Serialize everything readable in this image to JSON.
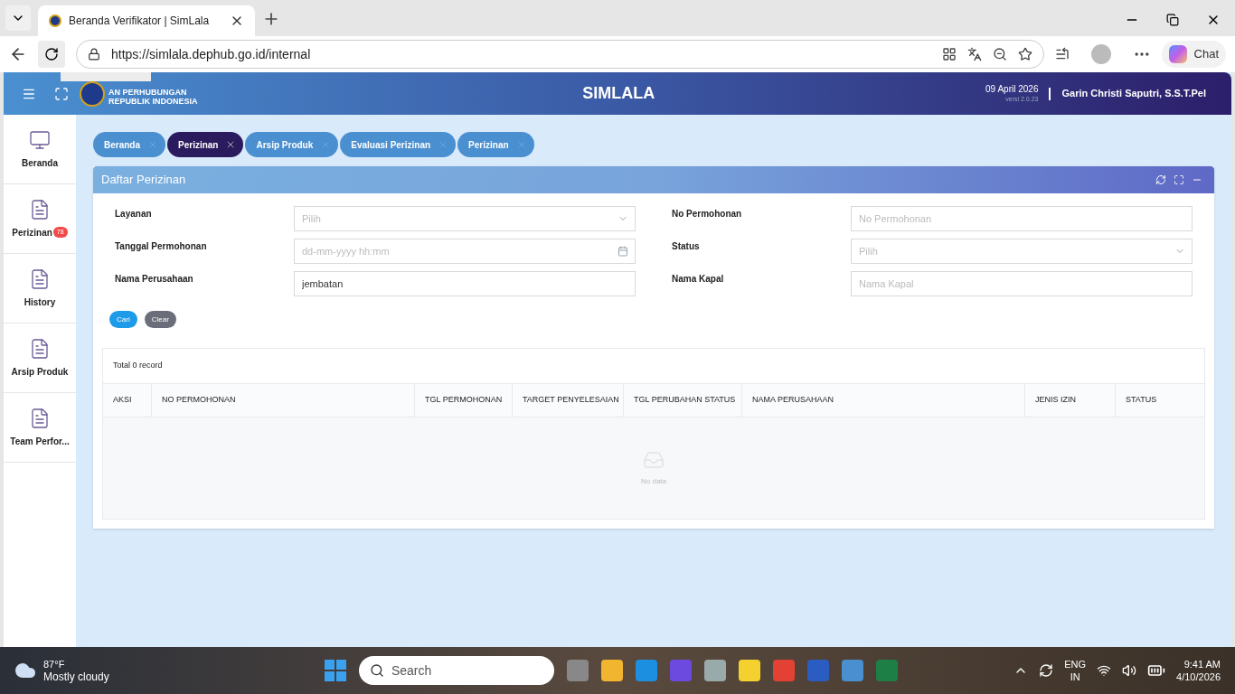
{
  "browser": {
    "tabs": [
      {
        "title": "Beranda Verifikator | SimLala",
        "selected": true
      }
    ],
    "url": "https://simlala.dephub.go.id/internal",
    "profile_label": "Chat"
  },
  "header": {
    "brand_lines": [
      "AN PERHUBUNGAN",
      "REPUBLIK INDONESIA"
    ],
    "title": "SIMLALA",
    "date": "09 April 2026",
    "version": "versi 2.0.23",
    "user": "Garin Christi Saputri, S.S.T.Pel"
  },
  "sidebar": {
    "items": [
      {
        "label": "Beranda",
        "kind": "monitor"
      },
      {
        "label": "Perizinan",
        "kind": "doc",
        "badge": "78"
      },
      {
        "label": "History",
        "kind": "doc"
      },
      {
        "label": "Arsip Produk",
        "kind": "doc"
      },
      {
        "label": "Team Perfor...",
        "kind": "doc"
      }
    ]
  },
  "page_tabs": [
    {
      "label": "Beranda",
      "selected": false
    },
    {
      "label": "Perizinan",
      "selected": true
    },
    {
      "label": "Arsip Produk",
      "selected": false
    },
    {
      "label": "Evaluasi Perizinan",
      "selected": false
    },
    {
      "label": "Perizinan",
      "selected": false
    }
  ],
  "panel": {
    "title": "Daftar Perizinan",
    "fields_left": [
      {
        "label": "Layanan",
        "kind": "select",
        "placeholder": "Pilih"
      },
      {
        "label": "Tanggal Permohonan",
        "kind": "date",
        "placeholder": "dd-mm-yyyy hh:mm"
      },
      {
        "label": "Nama Perusahaan",
        "kind": "text",
        "value": "jembatan"
      }
    ],
    "fields_right": [
      {
        "label": "No Permohonan",
        "kind": "text",
        "placeholder": "No Permohonan"
      },
      {
        "label": "Status",
        "kind": "select",
        "placeholder": "Pilih"
      },
      {
        "label": "Nama Kapal",
        "kind": "text",
        "placeholder": "Nama Kapal"
      }
    ],
    "buttons": [
      {
        "label": "Cari",
        "kind": "primary"
      },
      {
        "label": "Clear",
        "kind": "secondary"
      }
    ],
    "table": {
      "total": "Total 0 record",
      "columns": [
        "AKSI",
        "NO PERMOHONAN",
        "TGL PERMOHONAN",
        "TARGET PENYELESAIAN",
        "TGL PERUBAHAN STATUS",
        "NAMA PERUSAHAAN",
        "JENIS IZIN",
        "STATUS"
      ],
      "empty_text": "No data"
    }
  },
  "taskbar": {
    "temperature": "87°F",
    "weather": "Mostly cloudy",
    "search_placeholder": "Search",
    "language": "ENG",
    "region": "IN",
    "time": "9:41 AM",
    "date": "4/10/2026"
  }
}
